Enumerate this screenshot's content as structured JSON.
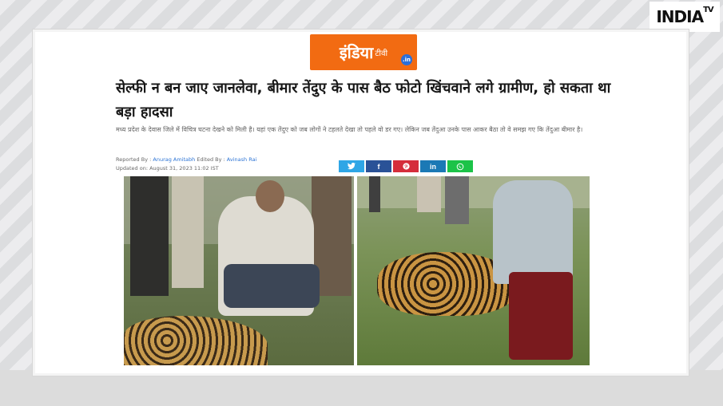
{
  "corner_logo": {
    "brand": "INDIA",
    "suffix": "TV"
  },
  "site_logo": {
    "text": "इंडिया",
    "tv": "टीवी",
    "domain": ".in"
  },
  "article": {
    "headline": "सेल्फी न बन जाए जानलेवा, बीमार तेंदुए के पास बैठ फोटो खिंचवाने लगे ग्रामीण, हो सकता था बड़ा हादसा",
    "summary": "मध्य प्रदेश के देवास जिले में विचित्र घटना देखने को मिली है। यहां एक तेंदुए को जब लोगों ने टहलते देखा तो पहले वो डर गए। लेकिन जब तेंदुआ उनके पास आकर बैठा तो वे समझ गए कि तेंदुआ बीमार है।",
    "reported_by_label": "Reported By :",
    "reporter": "Anurag Amitabh",
    "edited_by_label": "Edited By :",
    "editor": "Avinash Rai",
    "updated": "Updated on: August 31, 2023 11:02 IST"
  },
  "share": {
    "twitter": "twitter-icon",
    "facebook": "facebook-icon",
    "pinterest": "pinterest-icon",
    "linkedin": "linkedin-icon",
    "whatsapp": "whatsapp-icon"
  },
  "colors": {
    "brand_orange": "#f26b12",
    "link_blue": "#2c74d5"
  }
}
